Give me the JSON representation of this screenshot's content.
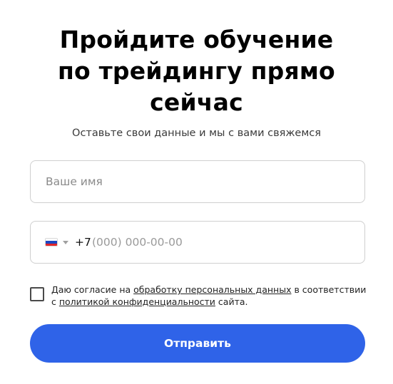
{
  "form": {
    "title_lines": [
      "Пройдите обучение",
      "по трейдингу прямо",
      "сейчас"
    ],
    "subtitle": "Оставьте свои данные и мы с вами свяжемся",
    "name_field": {
      "placeholder": "Ваше имя",
      "value": ""
    },
    "phone_field": {
      "country_flag": "russia-flag-icon",
      "dial_code": "+7",
      "placeholder": "(000) 000-00-00",
      "value": ""
    },
    "consent": {
      "checked": false,
      "text_before": "Даю согласие на ",
      "link1": "обработку персональных данных",
      "text_middle": " в соответствии с ",
      "link2": "политикой конфиденциальности",
      "text_after": " сайта."
    },
    "submit_label": "Отправить",
    "colors": {
      "accent": "#2f63e8",
      "border": "#cfcfcf",
      "flag_white": "#ffffff",
      "flag_blue": "#1c47c2",
      "flag_red": "#e0262a"
    }
  }
}
